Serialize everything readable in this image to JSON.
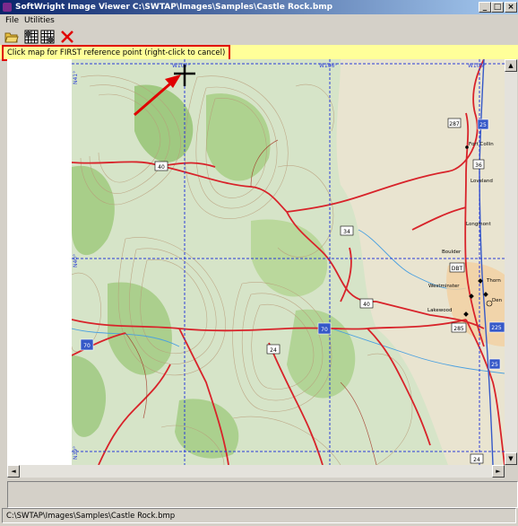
{
  "window": {
    "title": "SoftWright Image Viewer C:\\SWTAP\\Images\\Samples\\Castle Rock.bmp",
    "minimize_glyph": "_",
    "maximize_glyph": "□",
    "close_glyph": "×"
  },
  "menu": {
    "items": [
      "File",
      "Utilities"
    ]
  },
  "toolbar": {
    "tools": [
      {
        "icon": "open-folder-icon"
      },
      {
        "icon": "grid-icon"
      },
      {
        "icon": "grid-icon"
      },
      {
        "icon": "cancel-x-icon",
        "color": "#e00000"
      }
    ]
  },
  "hint": {
    "text": "Click map for FIRST reference point (right-click to cancel)",
    "border_color": "#e00000"
  },
  "map": {
    "top_labels": [
      "W107°",
      "W106°",
      "W105°"
    ],
    "side_labels": [
      "N41°",
      "N40°",
      "N39°"
    ],
    "routes": [
      "287",
      "25",
      "40",
      "34",
      "36",
      "DBT",
      "40",
      "70",
      "70",
      "24",
      "285",
      "225",
      "25",
      "24"
    ],
    "towns": [
      "Fort Collins",
      "Loveland",
      "Longmont",
      "Boulder",
      "Westminster",
      "Thornton",
      "Lakewood",
      "Denver"
    ],
    "town_display": [
      "Fort Collin",
      "Loveland",
      "Longmont",
      "Boulder",
      "Westminster",
      "Thorn",
      "Lakewood",
      "Den"
    ],
    "grid_color": "#2a3cd8",
    "road_color": "#d8232a"
  },
  "scroll": {
    "up": "▲",
    "down": "▼",
    "left": "◄",
    "right": "►"
  },
  "status": {
    "path": "C:\\SWTAP\\Images\\Samples\\Castle Rock.bmp"
  }
}
